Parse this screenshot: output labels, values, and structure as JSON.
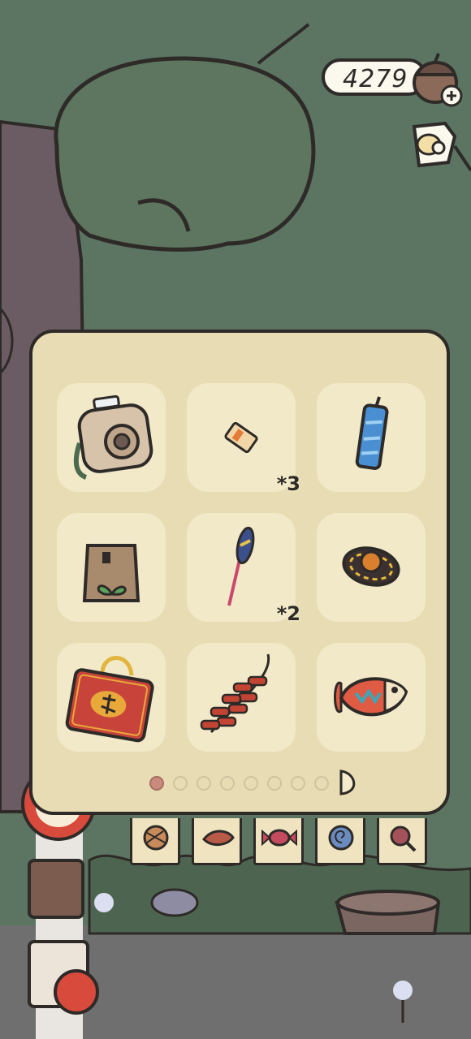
{
  "hud": {
    "clover_count": "4279",
    "clover_icon": "acorn-plus-icon",
    "note_icon": "note-icon"
  },
  "inventory": {
    "slots": [
      {
        "item": "camera",
        "qty": ""
      },
      {
        "item": "ticket",
        "qty": "*3"
      },
      {
        "item": "blue-firework-tube",
        "qty": ""
      },
      {
        "item": "seed-bag",
        "qty": ""
      },
      {
        "item": "sparkler-stick",
        "qty": "*2"
      },
      {
        "item": "straw-hat",
        "qty": ""
      },
      {
        "item": "red-lucky-gift-bag",
        "qty": ""
      },
      {
        "item": "firecracker-string",
        "qty": ""
      },
      {
        "item": "fish-lantern",
        "qty": ""
      }
    ],
    "page_dots": 8,
    "current_page": 1
  },
  "tabs": [
    "yarn-ball-icon",
    "leaf-icon",
    "candy-icon",
    "snail-shell-icon",
    "magnifier-icon"
  ],
  "colors": {
    "panel": "#e7dcb3",
    "slot": "#f1e9c8",
    "outline": "#2e2a28",
    "forest": "#5c7462",
    "active_dot": "#c98b7d"
  }
}
